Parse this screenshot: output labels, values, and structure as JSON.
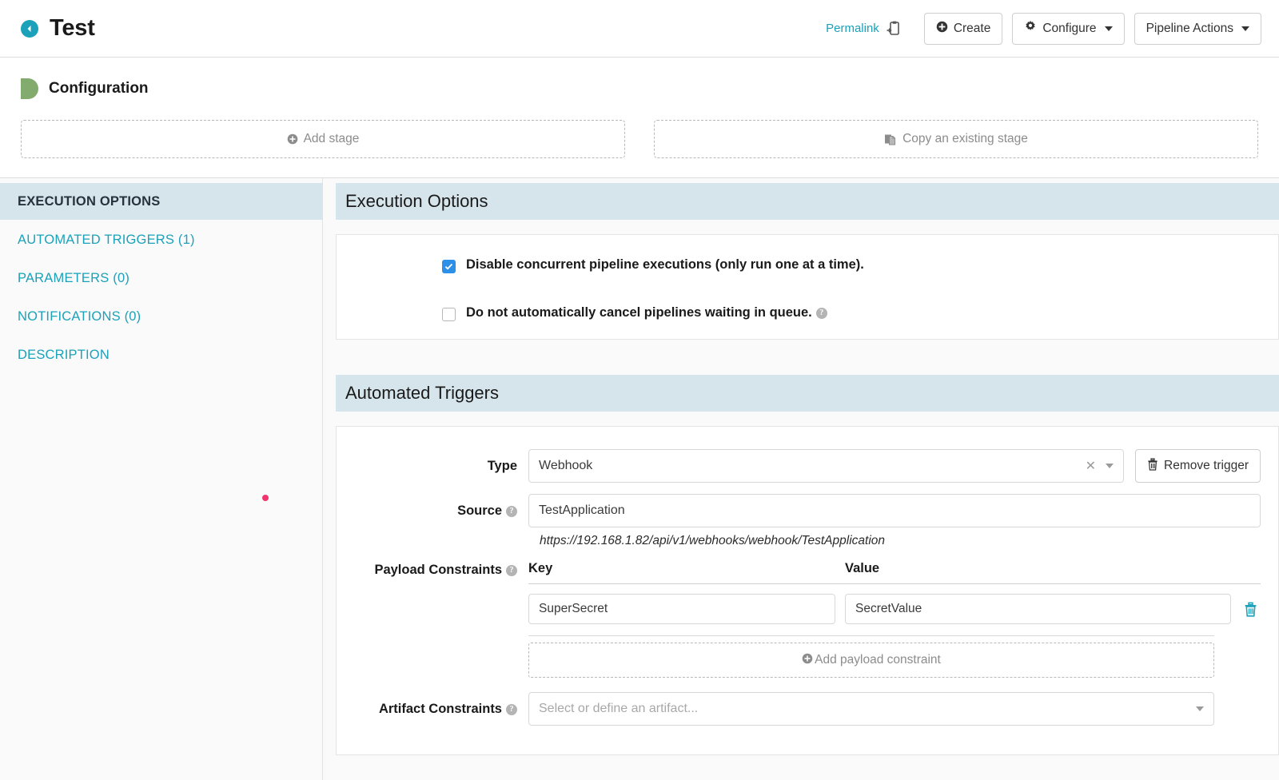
{
  "header": {
    "title": "Test",
    "back_icon": "circle-left-arrow-icon",
    "permalink_label": "Permalink",
    "permalink_icon": "clipboard-paste-icon",
    "buttons": [
      {
        "label": "Create",
        "icon": "plus-circle-icon"
      },
      {
        "label": "Configure",
        "icon": "gear-icon",
        "caret": true
      },
      {
        "label": "Pipeline Actions",
        "caret": true
      }
    ]
  },
  "configuration": {
    "label": "Configuration",
    "stage_icon": "pipeline-stage-icon",
    "add_stage_label": "Add stage",
    "add_stage_icon": "plus-circle-icon",
    "copy_stage_label": "Copy an existing stage",
    "copy_stage_icon": "copy-files-icon"
  },
  "sidebar": {
    "items": [
      {
        "label": "EXECUTION OPTIONS",
        "active": true
      },
      {
        "label": "AUTOMATED TRIGGERS (1)",
        "active": false
      },
      {
        "label": "PARAMETERS (0)",
        "active": false
      },
      {
        "label": "NOTIFICATIONS (0)",
        "active": false
      },
      {
        "label": "DESCRIPTION",
        "active": false
      }
    ],
    "cursor_dot_color": "#f3336e"
  },
  "execution_options": {
    "section_title": "Execution Options",
    "checkboxes": [
      {
        "label": "Disable concurrent pipeline executions (only run one at a time).",
        "checked": true,
        "has_help": false
      },
      {
        "label": "Do not automatically cancel pipelines waiting in queue.",
        "checked": false,
        "has_help": true
      }
    ]
  },
  "automated_triggers": {
    "section_title": "Automated Triggers",
    "type": {
      "label": "Type",
      "value": "Webhook",
      "clear_icon": "clear-x-icon",
      "caret_icon": "chevron-down-icon"
    },
    "remove_trigger": {
      "label": "Remove trigger",
      "icon": "trash-icon"
    },
    "source": {
      "label": "Source",
      "value": "TestApplication",
      "has_help": true,
      "url_hint": "https://192.168.1.82/api/v1/webhooks/webhook/TestApplication"
    },
    "payload_constraints": {
      "label": "Payload Constraints",
      "has_help": true,
      "columns": [
        "Key",
        "Value"
      ],
      "rows": [
        {
          "key": "SuperSecret",
          "value": "SecretValue",
          "delete_icon": "trash-icon"
        }
      ],
      "add_label": "Add payload constraint",
      "add_icon": "plus-circle-icon"
    },
    "artifact_constraints": {
      "label": "Artifact Constraints",
      "has_help": true,
      "placeholder": "Select or define an artifact...",
      "caret_icon": "chevron-down-icon"
    }
  },
  "colors": {
    "accent_teal": "#1ba1ba",
    "section_band": "#d6e5ec",
    "checkbox_blue": "#2c8fe8",
    "stage_green": "#83ab6d",
    "cursor_pink": "#f3336e"
  }
}
